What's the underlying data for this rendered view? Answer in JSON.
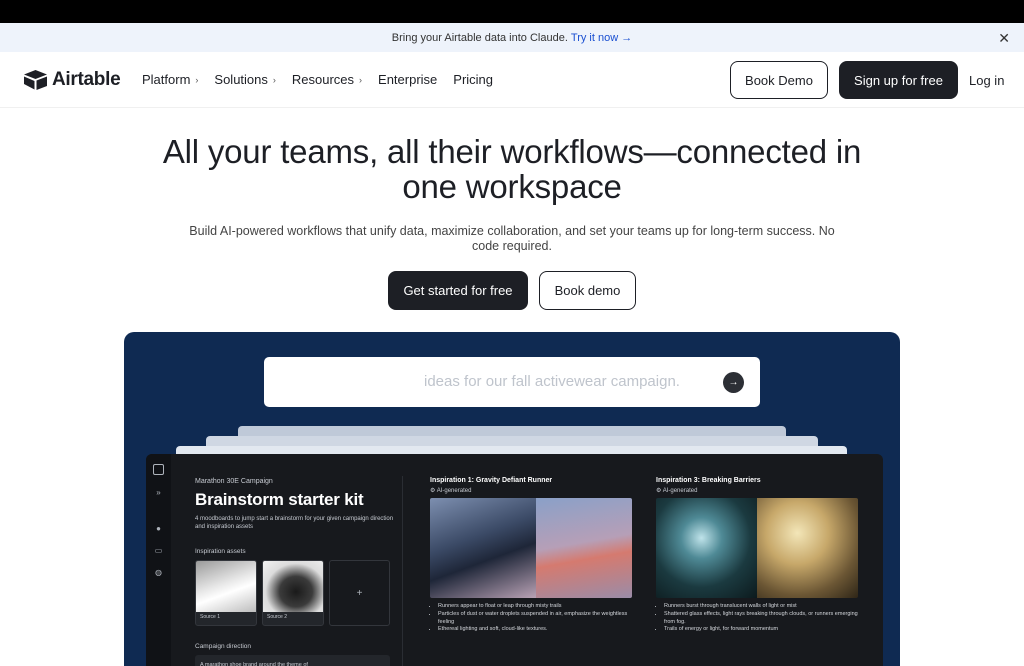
{
  "announcement": {
    "text": "Bring your Airtable data into Claude.",
    "link": "Try it now →"
  },
  "nav": {
    "logo_text": "Airtable",
    "menu": [
      {
        "label": "Platform",
        "has_chevron": true
      },
      {
        "label": "Solutions",
        "has_chevron": true
      },
      {
        "label": "Resources",
        "has_chevron": true
      },
      {
        "label": "Enterprise",
        "has_chevron": false
      },
      {
        "label": "Pricing",
        "has_chevron": false
      }
    ],
    "book_demo": "Book Demo",
    "signup": "Sign up for free",
    "login": "Log in"
  },
  "hero": {
    "title": "All your teams, all their workflows—connected in one workspace",
    "subtitle": "Build AI-powered workflows that unify data, maximize collaboration, and set your teams up for long-term success. No code required.",
    "cta_primary": "Get started for free",
    "cta_secondary": "Book demo"
  },
  "demo": {
    "prompt_text": "ideas for our fall activewear campaign.",
    "campaign": "Marathon 30E Campaign",
    "kit_title": "Brainstorm starter kit",
    "kit_desc": "4 moodboards to jump start a brainstorm for your given campaign direction and inspiration assets",
    "assets_label": "Inspiration assets",
    "asset1": "Source 1",
    "asset2": "Source 2",
    "direction_label": "Campaign direction",
    "direction_text": "A marathon shoe brand around the theme of",
    "insp1": {
      "title": "Inspiration 1: Gravity Defiant Runner",
      "tag": "AI-generated",
      "bullets": [
        "Runners appear to float or leap through misty trails",
        "Particles of dust or water droplets suspended in air, emphasize the weightless feeling",
        "Ethereal lighting and soft, cloud-like textures."
      ]
    },
    "insp3": {
      "title": "Inspiration 3: Breaking Barriers",
      "tag": "AI-generated",
      "bullets": [
        "Runners burst through translucent walls of light or mist",
        "Shattered glass effects, light rays breaking through clouds, or runners emerging from fog.",
        "Trails of energy or light, for forward momentum"
      ]
    }
  },
  "colors": {
    "dark": "#1d1f25",
    "stage": "#0f2a52",
    "link": "#1a4fd1"
  }
}
